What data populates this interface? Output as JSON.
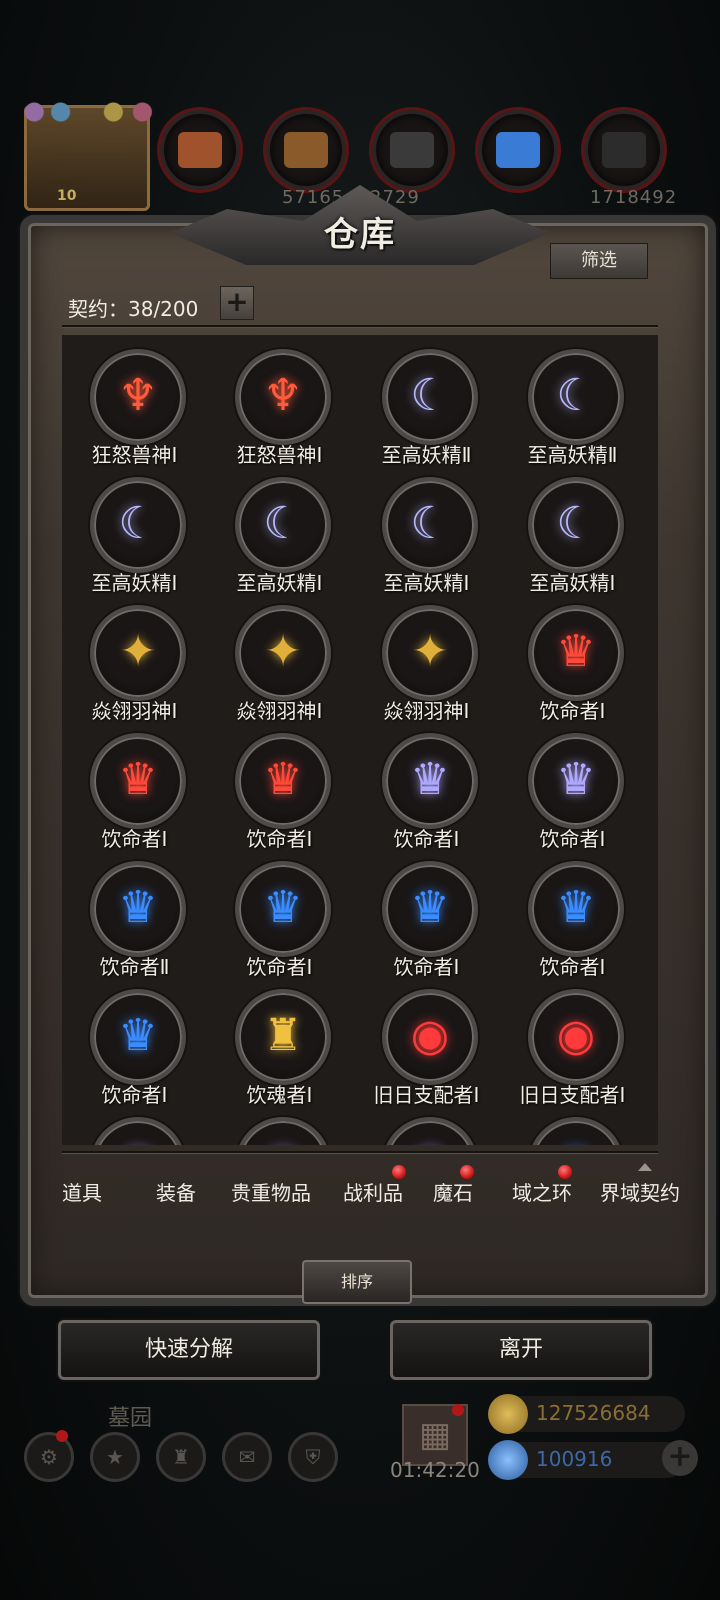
{
  "top_bar": {
    "event_level": "10",
    "resources": [
      {
        "icon": "meat-resource-icon",
        "value": "",
        "color": "#a0522d"
      },
      {
        "icon": "wood-resource-icon",
        "value": "57165",
        "color": "#8b5a2b"
      },
      {
        "icon": "iron-resource-icon",
        "value": "2729",
        "color": "#3a3a3a"
      },
      {
        "icon": "crystal-resource-icon",
        "value": "",
        "color": "#3a7bd5"
      },
      {
        "icon": "stone-resource-icon",
        "value": "1718492",
        "color": "#2c2c2c"
      }
    ]
  },
  "panel": {
    "title": "仓库",
    "filter_label": "筛选",
    "contract_label": "契约：38/200",
    "plus_label": "+",
    "sort_label": "排序"
  },
  "items": [
    {
      "name": "狂怒兽神Ⅰ",
      "icon": "rage-beast-emblem-icon",
      "glyph": "♆",
      "color": "#ff5a3c"
    },
    {
      "name": "狂怒兽神Ⅰ",
      "icon": "rage-beast-emblem-icon",
      "glyph": "♆",
      "color": "#ff5a3c"
    },
    {
      "name": "至高妖精Ⅱ",
      "icon": "supreme-fairy-emblem-icon",
      "glyph": "☾",
      "color": "#b8b8ff"
    },
    {
      "name": "至高妖精Ⅱ",
      "icon": "supreme-fairy-emblem-icon",
      "glyph": "☾",
      "color": "#b8b8ff"
    },
    {
      "name": "至高妖精Ⅰ",
      "icon": "supreme-fairy-emblem-icon",
      "glyph": "☾",
      "color": "#b8b8ff"
    },
    {
      "name": "至高妖精Ⅰ",
      "icon": "supreme-fairy-emblem-icon",
      "glyph": "☾",
      "color": "#b8b8ff"
    },
    {
      "name": "至高妖精Ⅰ",
      "icon": "supreme-fairy-emblem-icon",
      "glyph": "☾",
      "color": "#b8b8ff"
    },
    {
      "name": "至高妖精Ⅰ",
      "icon": "supreme-fairy-emblem-icon",
      "glyph": "☾",
      "color": "#b8b8ff"
    },
    {
      "name": "焱翎羽神Ⅰ",
      "icon": "flame-feather-emblem-icon",
      "glyph": "✦",
      "color": "#e0b03a"
    },
    {
      "name": "焱翎羽神Ⅰ",
      "icon": "flame-feather-emblem-icon",
      "glyph": "✦",
      "color": "#e0b03a"
    },
    {
      "name": "焱翎羽神Ⅰ",
      "icon": "flame-feather-emblem-icon",
      "glyph": "✦",
      "color": "#e0b03a"
    },
    {
      "name": "饮命者Ⅰ",
      "icon": "life-drinker-emblem-icon",
      "glyph": "♛",
      "color": "#ff4a3a"
    },
    {
      "name": "饮命者Ⅰ",
      "icon": "life-drinker-emblem-icon",
      "glyph": "♛",
      "color": "#ff4a3a"
    },
    {
      "name": "饮命者Ⅰ",
      "icon": "life-drinker-emblem-icon",
      "glyph": "♛",
      "color": "#ff4a3a"
    },
    {
      "name": "饮命者Ⅰ",
      "icon": "life-drinker-emblem-icon",
      "glyph": "♛",
      "color": "#b0a8ff"
    },
    {
      "name": "饮命者Ⅰ",
      "icon": "life-drinker-emblem-icon",
      "glyph": "♛",
      "color": "#b0a8ff"
    },
    {
      "name": "饮命者Ⅱ",
      "icon": "life-drinker-emblem-icon",
      "glyph": "♛",
      "color": "#3a8cff"
    },
    {
      "name": "饮命者Ⅰ",
      "icon": "life-drinker-emblem-icon",
      "glyph": "♛",
      "color": "#3a8cff"
    },
    {
      "name": "饮命者Ⅰ",
      "icon": "life-drinker-emblem-icon",
      "glyph": "♛",
      "color": "#3a8cff"
    },
    {
      "name": "饮命者Ⅰ",
      "icon": "life-drinker-emblem-icon",
      "glyph": "♛",
      "color": "#3a8cff"
    },
    {
      "name": "饮命者Ⅰ",
      "icon": "life-drinker-emblem-icon",
      "glyph": "♛",
      "color": "#3a8cff"
    },
    {
      "name": "饮魂者Ⅰ",
      "icon": "soul-drinker-emblem-icon",
      "glyph": "♜",
      "color": "#f0c040"
    },
    {
      "name": "旧日支配者Ⅰ",
      "icon": "old-ruler-eye-emblem-icon",
      "glyph": "◉",
      "color": "#ff3a3a"
    },
    {
      "name": "旧日支配者Ⅰ",
      "icon": "old-ruler-eye-emblem-icon",
      "glyph": "◉",
      "color": "#ff3a3a"
    },
    {
      "name": "",
      "icon": "emblem-partial-icon",
      "glyph": "♛",
      "color": "#b0a8ff"
    },
    {
      "name": "",
      "icon": "emblem-partial-icon",
      "glyph": "♛",
      "color": "#b0a8ff"
    },
    {
      "name": "",
      "icon": "emblem-partial-icon",
      "glyph": "♛",
      "color": "#b0a8ff"
    },
    {
      "name": "",
      "icon": "emblem-partial-icon",
      "glyph": "♛",
      "color": "#3a8cff"
    }
  ],
  "tabs": [
    {
      "label": "道具",
      "badge": false
    },
    {
      "label": "装备",
      "badge": false
    },
    {
      "label": "贵重物品",
      "badge": false
    },
    {
      "label": "战利品",
      "badge": true
    },
    {
      "label": "魔石",
      "badge": true
    },
    {
      "label": "域之环",
      "badge": true
    },
    {
      "label": "界域契约",
      "badge": false
    }
  ],
  "actions": {
    "quick_decompose": "快速分解",
    "leave": "离开"
  },
  "bottom_hud": {
    "graveyard_label": "墓园",
    "timer": "01:42:20",
    "gold": "127526684",
    "gems": "100916",
    "gold_color": "#c9a24a",
    "gem_color": "#4a8ad8",
    "plus_label": "+"
  }
}
